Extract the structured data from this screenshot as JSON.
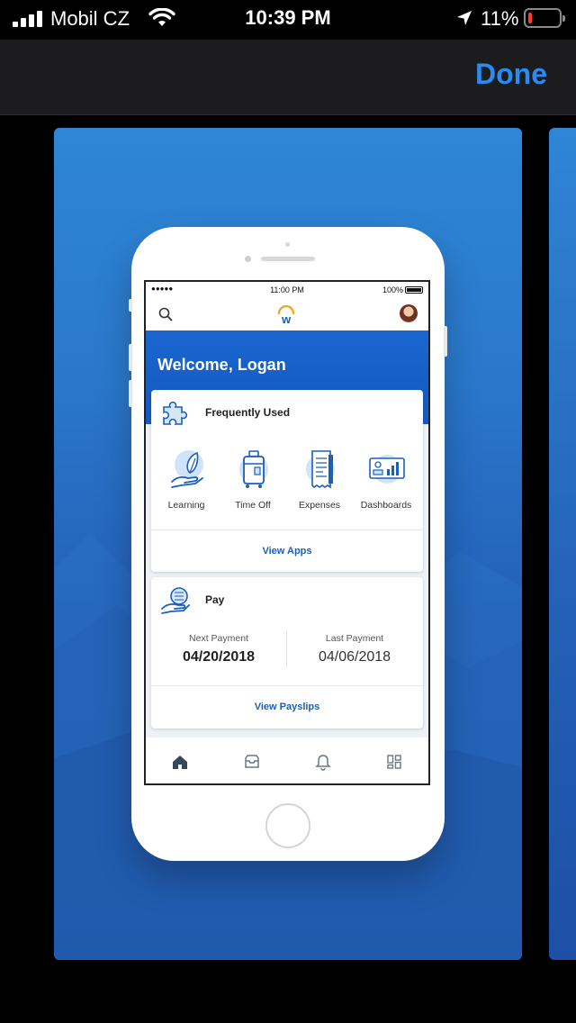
{
  "status_bar": {
    "carrier": "Mobil CZ",
    "time": "10:39 PM",
    "battery_percent": "11%",
    "battery_level": 0.11,
    "battery_color": "#ff3b30"
  },
  "top_bar": {
    "done_label": "Done",
    "accent_color": "#2a8bf2"
  },
  "preview": {
    "status": {
      "signal": "●●●●●",
      "time": "11:00 PM",
      "battery": "100%"
    },
    "header": {
      "search_icon": "search-icon",
      "logo_letter": "w",
      "avatar": "user-avatar"
    },
    "welcome": "Welcome, Logan",
    "frequently_used": {
      "title": "Frequently Used",
      "icon": "puzzle-icon",
      "apps": [
        {
          "label": "Learning",
          "icon": "learning-leaf-hand-icon"
        },
        {
          "label": "Time Off",
          "icon": "suitcase-icon"
        },
        {
          "label": "Expenses",
          "icon": "receipt-icon"
        },
        {
          "label": "Dashboards",
          "icon": "dashboard-chart-icon"
        }
      ],
      "link": "View Apps"
    },
    "pay": {
      "title": "Pay",
      "icon": "hand-coins-icon",
      "next_label": "Next Payment",
      "next_value": "04/20/2018",
      "last_label": "Last Payment",
      "last_value": "04/06/2018",
      "link": "View Payslips"
    },
    "tabs": [
      "home-icon",
      "inbox-icon",
      "bell-icon",
      "apps-grid-icon"
    ],
    "brand_blue": "#1a66cf"
  }
}
